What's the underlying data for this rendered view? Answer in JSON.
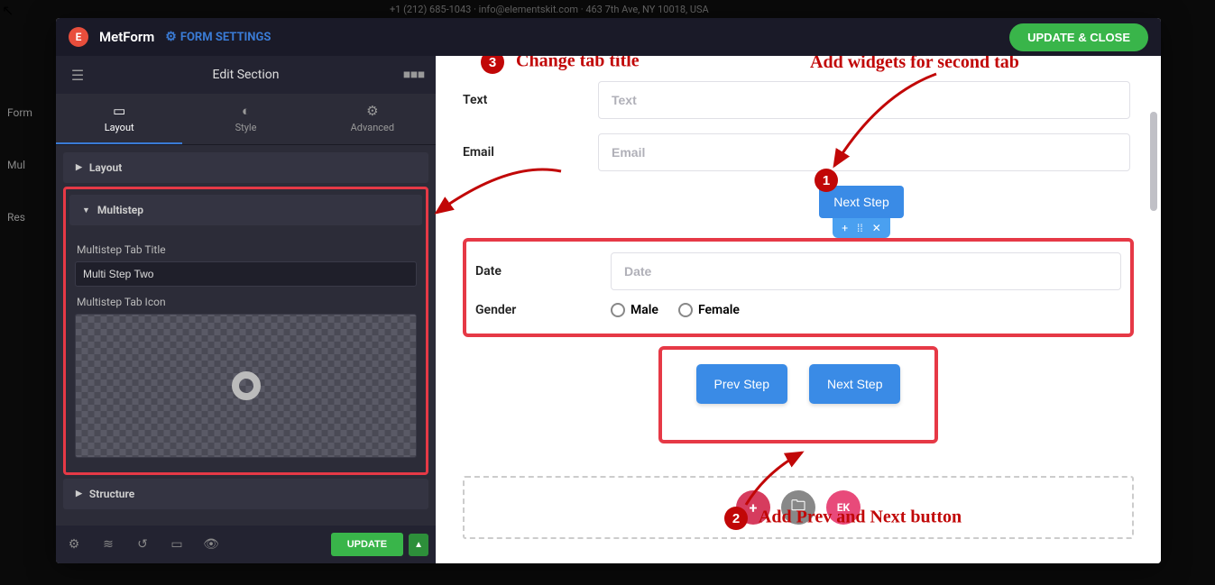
{
  "underlay_info": "+1 (212) 685-1043 · info@elementskit.com · 463 7th Ave, NY 10018, USA",
  "underlay_nav": [
    "Form",
    "Mul",
    "Res"
  ],
  "header": {
    "brand": "MetForm",
    "brand_logo": "E",
    "settings_link": "FORM SETTINGS",
    "update_close": "UPDATE & CLOSE"
  },
  "panel": {
    "title": "Edit Section",
    "tabs": {
      "layout": "Layout",
      "style": "Style",
      "advanced": "Advanced"
    },
    "accordion": {
      "layout": "Layout",
      "multistep": "Multistep",
      "multistep_title_label": "Multistep Tab Title",
      "multistep_title_value": "Multi Step Two",
      "multistep_icon_label": "Multistep Tab Icon",
      "structure": "Structure"
    },
    "update_btn": "UPDATE"
  },
  "preview": {
    "text_label": "Text",
    "text_placeholder": "Text",
    "email_label": "Email",
    "email_placeholder": "Email",
    "next_step": "Next Step",
    "date_label": "Date",
    "date_placeholder": "Date",
    "gender_label": "Gender",
    "opt_male": "Male",
    "opt_female": "Female",
    "prev_step": "Prev Step",
    "next_step2": "Next Step",
    "circle_plus": "+",
    "circle_folder": "▭",
    "circle_ek": "EK"
  },
  "annotations": {
    "a1": "Add widgets for second tab",
    "a2": "Add Prev and Next button",
    "a3": "Change tab title"
  }
}
